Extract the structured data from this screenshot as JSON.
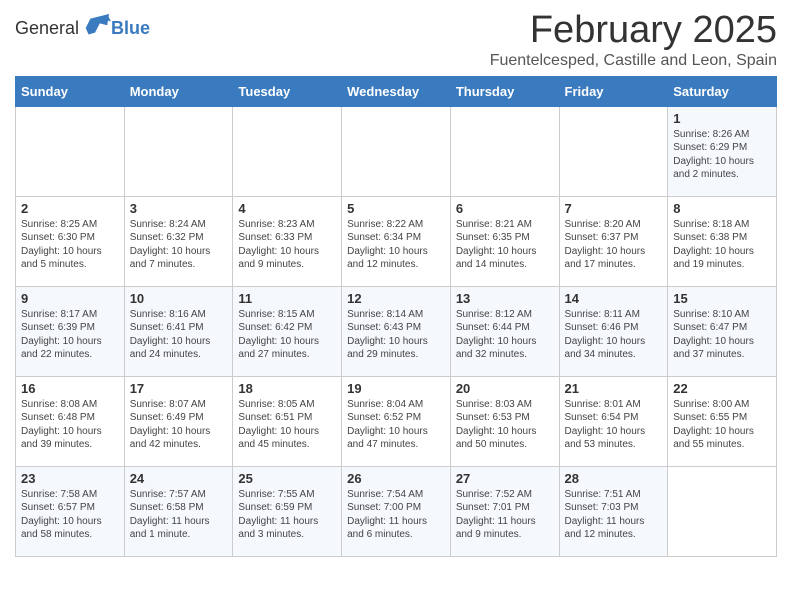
{
  "logo": {
    "general": "General",
    "blue": "Blue"
  },
  "header": {
    "month": "February 2025",
    "location": "Fuentelcesped, Castille and Leon, Spain"
  },
  "weekdays": [
    "Sunday",
    "Monday",
    "Tuesday",
    "Wednesday",
    "Thursday",
    "Friday",
    "Saturday"
  ],
  "weeks": [
    [
      {
        "day": "",
        "info": ""
      },
      {
        "day": "",
        "info": ""
      },
      {
        "day": "",
        "info": ""
      },
      {
        "day": "",
        "info": ""
      },
      {
        "day": "",
        "info": ""
      },
      {
        "day": "",
        "info": ""
      },
      {
        "day": "1",
        "info": "Sunrise: 8:26 AM\nSunset: 6:29 PM\nDaylight: 10 hours and 2 minutes."
      }
    ],
    [
      {
        "day": "2",
        "info": "Sunrise: 8:25 AM\nSunset: 6:30 PM\nDaylight: 10 hours and 5 minutes."
      },
      {
        "day": "3",
        "info": "Sunrise: 8:24 AM\nSunset: 6:32 PM\nDaylight: 10 hours and 7 minutes."
      },
      {
        "day": "4",
        "info": "Sunrise: 8:23 AM\nSunset: 6:33 PM\nDaylight: 10 hours and 9 minutes."
      },
      {
        "day": "5",
        "info": "Sunrise: 8:22 AM\nSunset: 6:34 PM\nDaylight: 10 hours and 12 minutes."
      },
      {
        "day": "6",
        "info": "Sunrise: 8:21 AM\nSunset: 6:35 PM\nDaylight: 10 hours and 14 minutes."
      },
      {
        "day": "7",
        "info": "Sunrise: 8:20 AM\nSunset: 6:37 PM\nDaylight: 10 hours and 17 minutes."
      },
      {
        "day": "8",
        "info": "Sunrise: 8:18 AM\nSunset: 6:38 PM\nDaylight: 10 hours and 19 minutes."
      }
    ],
    [
      {
        "day": "9",
        "info": "Sunrise: 8:17 AM\nSunset: 6:39 PM\nDaylight: 10 hours and 22 minutes."
      },
      {
        "day": "10",
        "info": "Sunrise: 8:16 AM\nSunset: 6:41 PM\nDaylight: 10 hours and 24 minutes."
      },
      {
        "day": "11",
        "info": "Sunrise: 8:15 AM\nSunset: 6:42 PM\nDaylight: 10 hours and 27 minutes."
      },
      {
        "day": "12",
        "info": "Sunrise: 8:14 AM\nSunset: 6:43 PM\nDaylight: 10 hours and 29 minutes."
      },
      {
        "day": "13",
        "info": "Sunrise: 8:12 AM\nSunset: 6:44 PM\nDaylight: 10 hours and 32 minutes."
      },
      {
        "day": "14",
        "info": "Sunrise: 8:11 AM\nSunset: 6:46 PM\nDaylight: 10 hours and 34 minutes."
      },
      {
        "day": "15",
        "info": "Sunrise: 8:10 AM\nSunset: 6:47 PM\nDaylight: 10 hours and 37 minutes."
      }
    ],
    [
      {
        "day": "16",
        "info": "Sunrise: 8:08 AM\nSunset: 6:48 PM\nDaylight: 10 hours and 39 minutes."
      },
      {
        "day": "17",
        "info": "Sunrise: 8:07 AM\nSunset: 6:49 PM\nDaylight: 10 hours and 42 minutes."
      },
      {
        "day": "18",
        "info": "Sunrise: 8:05 AM\nSunset: 6:51 PM\nDaylight: 10 hours and 45 minutes."
      },
      {
        "day": "19",
        "info": "Sunrise: 8:04 AM\nSunset: 6:52 PM\nDaylight: 10 hours and 47 minutes."
      },
      {
        "day": "20",
        "info": "Sunrise: 8:03 AM\nSunset: 6:53 PM\nDaylight: 10 hours and 50 minutes."
      },
      {
        "day": "21",
        "info": "Sunrise: 8:01 AM\nSunset: 6:54 PM\nDaylight: 10 hours and 53 minutes."
      },
      {
        "day": "22",
        "info": "Sunrise: 8:00 AM\nSunset: 6:55 PM\nDaylight: 10 hours and 55 minutes."
      }
    ],
    [
      {
        "day": "23",
        "info": "Sunrise: 7:58 AM\nSunset: 6:57 PM\nDaylight: 10 hours and 58 minutes."
      },
      {
        "day": "24",
        "info": "Sunrise: 7:57 AM\nSunset: 6:58 PM\nDaylight: 11 hours and 1 minute."
      },
      {
        "day": "25",
        "info": "Sunrise: 7:55 AM\nSunset: 6:59 PM\nDaylight: 11 hours and 3 minutes."
      },
      {
        "day": "26",
        "info": "Sunrise: 7:54 AM\nSunset: 7:00 PM\nDaylight: 11 hours and 6 minutes."
      },
      {
        "day": "27",
        "info": "Sunrise: 7:52 AM\nSunset: 7:01 PM\nDaylight: 11 hours and 9 minutes."
      },
      {
        "day": "28",
        "info": "Sunrise: 7:51 AM\nSunset: 7:03 PM\nDaylight: 11 hours and 12 minutes."
      },
      {
        "day": "",
        "info": ""
      }
    ]
  ]
}
